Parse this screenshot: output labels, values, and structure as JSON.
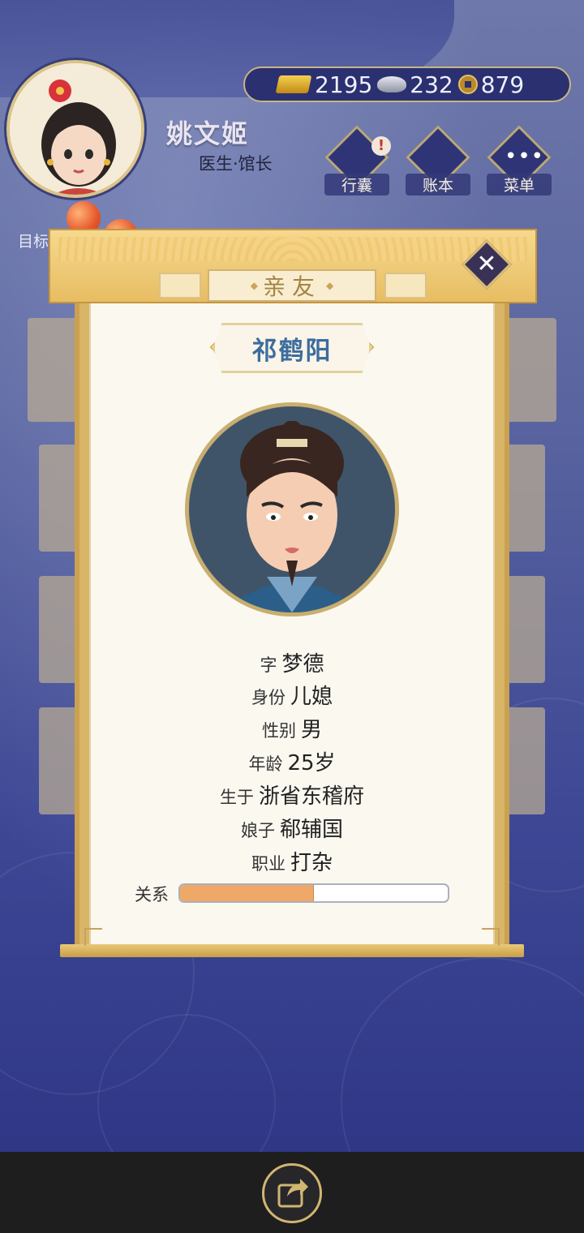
{
  "player": {
    "name": "姚文姬",
    "title": "医生·馆长"
  },
  "currency": {
    "gold": "2195",
    "silver": "232",
    "copper": "879"
  },
  "top_buttons": {
    "bag": "行囊",
    "ledger": "账本",
    "menu": "菜单"
  },
  "goal_label": "目标",
  "dialog": {
    "title": "亲友",
    "npc_name": "祁鹤阳",
    "rows": [
      {
        "key": "字",
        "value": "梦德"
      },
      {
        "key": "身份",
        "value": "儿媳"
      },
      {
        "key": "性别",
        "value": "男"
      },
      {
        "key": "年龄",
        "value": "25岁"
      },
      {
        "key": "生于",
        "value": "浙省东稽府"
      },
      {
        "key": "娘子",
        "value": "郗辅国"
      },
      {
        "key": "职业",
        "value": "打杂"
      }
    ],
    "relation_label": "关系",
    "relation_fraction": 0.5
  },
  "icons": {
    "close": "close-icon",
    "share": "share-icon",
    "bag": "bag-icon",
    "ledger": "ledger-icon",
    "menu": "more-icon"
  },
  "colors": {
    "relation_fill": "#efa867",
    "npc_name": "#3c6d9e",
    "scroll_gold": "#e7bd63"
  }
}
